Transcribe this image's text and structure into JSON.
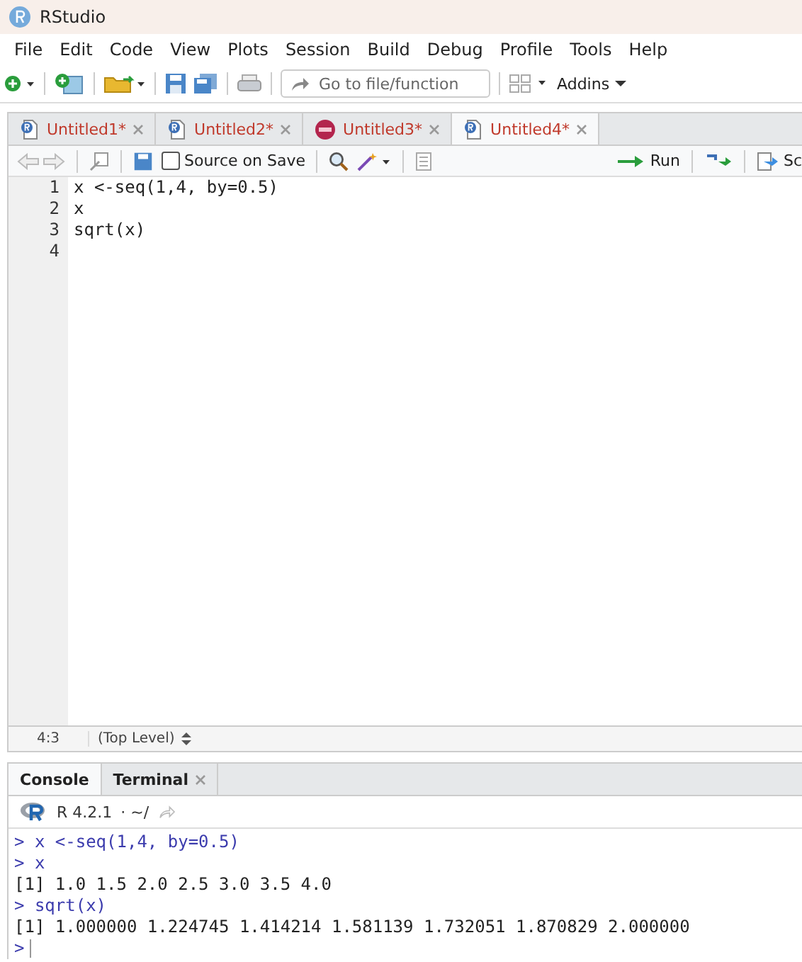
{
  "window": {
    "title": "RStudio"
  },
  "menu": [
    "File",
    "Edit",
    "Code",
    "View",
    "Plots",
    "Session",
    "Build",
    "Debug",
    "Profile",
    "Tools",
    "Help"
  ],
  "toolbar": {
    "goto_placeholder": "Go to file/function",
    "addins": "Addins"
  },
  "editor": {
    "tabs": [
      {
        "label": "Untitled1*",
        "kind": "r",
        "modified": true,
        "selected": false
      },
      {
        "label": "Untitled2*",
        "kind": "r",
        "modified": true,
        "selected": false
      },
      {
        "label": "Untitled3*",
        "kind": "rmd",
        "modified": true,
        "selected": false
      },
      {
        "label": "Untitled4*",
        "kind": "r",
        "modified": true,
        "selected": true
      }
    ],
    "source_on_save": {
      "label": "Source on Save",
      "checked": false
    },
    "run": "Run",
    "source": "Sc",
    "lines": [
      {
        "number": "1",
        "code": "x <-seq(1,4, by=0.5)"
      },
      {
        "number": "2",
        "code": "x"
      },
      {
        "number": "3",
        "code": "sqrt(x)"
      },
      {
        "number": "4"
      }
    ],
    "status": {
      "position": "4:3",
      "scope": "(Top Level)"
    }
  },
  "console": {
    "tabs": [
      {
        "label": "Console",
        "selected": true,
        "closable": false
      },
      {
        "label": "Terminal",
        "selected": false,
        "closable": true
      }
    ],
    "version": "R 4.2.1",
    "path": "· ~/",
    "lines": [
      {
        "kind": "input",
        "text": "> x <-seq(1,4, by=0.5)"
      },
      {
        "kind": "input",
        "text": "> x"
      },
      {
        "kind": "output",
        "text": "[1] 1.0 1.5 2.0 2.5 3.0 3.5 4.0"
      },
      {
        "kind": "input",
        "text": "> sqrt(x)"
      },
      {
        "kind": "output",
        "text": "[1] 1.000000 1.224745 1.414214 1.581139 1.732051 1.870829 2.000000"
      },
      {
        "kind": "prompt",
        "text": ">"
      }
    ]
  }
}
